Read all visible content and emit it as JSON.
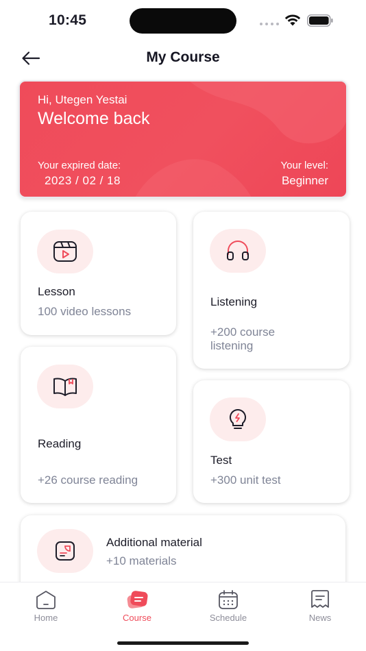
{
  "status_bar": {
    "time": "10:45"
  },
  "header": {
    "title": "My Course"
  },
  "banner": {
    "greeting": "Hi, Utegen Yestai",
    "welcome": "Welcome back",
    "expired_label": "Your expired date:",
    "expired_date": "2023 / 02 / 18",
    "level_label": "Your level:",
    "level_value": "Beginner"
  },
  "courses": [
    {
      "title": "Lesson",
      "subtitle": "100 video lessons",
      "icon": "video-play-icon"
    },
    {
      "title": "Listening",
      "subtitle": "+200 course listening",
      "icon": "headphones-icon"
    },
    {
      "title": "Reading",
      "subtitle": "+26 course reading",
      "icon": "open-book-icon"
    },
    {
      "title": "Test",
      "subtitle": "+300 unit test",
      "icon": "lightbulb-icon"
    },
    {
      "title": "Additional material",
      "subtitle": "+10 materials",
      "icon": "document-icon"
    }
  ],
  "nav": [
    {
      "label": "Home",
      "icon": "home-icon",
      "active": false
    },
    {
      "label": "Course",
      "icon": "course-icon",
      "active": true
    },
    {
      "label": "Schedule",
      "icon": "calendar-icon",
      "active": false
    },
    {
      "label": "News",
      "icon": "news-icon",
      "active": false
    }
  ],
  "colors": {
    "accent": "#ef4b5a",
    "icon_bg": "#fdecec",
    "subtitle": "#7f8496",
    "nav_inactive": "#8d8d99"
  }
}
